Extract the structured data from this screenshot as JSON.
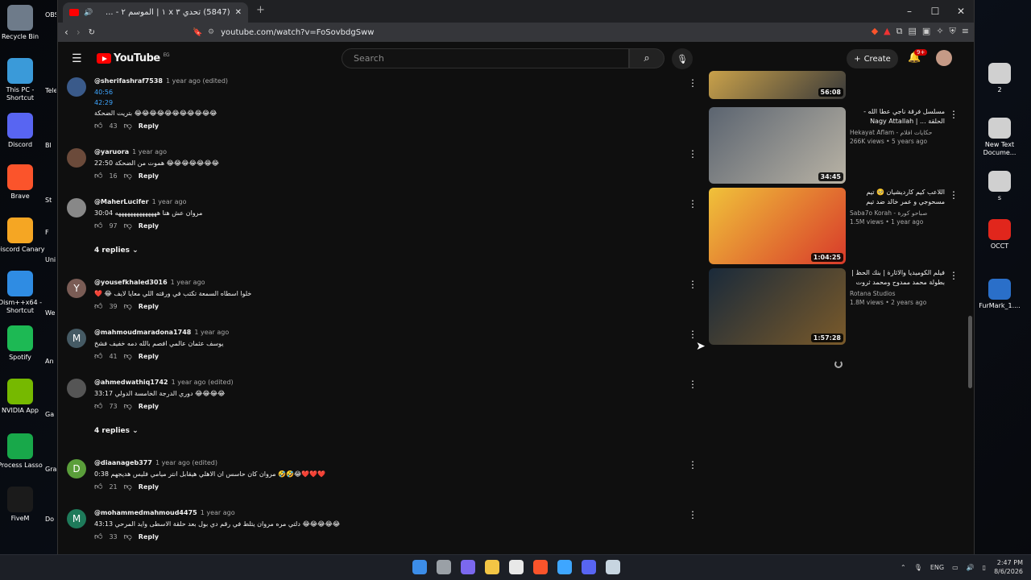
{
  "desktop": {
    "left_icons": [
      {
        "label": "Recycle Bin",
        "color": "#6e7b8a"
      },
      {
        "label": "This PC - Shortcut",
        "color": "#3a9ad9"
      },
      {
        "label": "Discord",
        "color": "#5865f2"
      },
      {
        "label": "Brave",
        "color": "#fb542b"
      },
      {
        "label": "Discord Canary",
        "color": "#f5a623"
      },
      {
        "label": "Dism++x64 - Shortcut",
        "color": "#2f8ce3"
      },
      {
        "label": "Spotify",
        "color": "#1db954"
      },
      {
        "label": "NVIDIA App",
        "color": "#76b900"
      },
      {
        "label": "Process Lasso",
        "color": "#18a84a"
      },
      {
        "label": "FiveM",
        "color": "#1b1b1b"
      }
    ],
    "partial_labels": [
      "OBS",
      "Tele",
      "Bl",
      "St",
      "F",
      "Uni",
      "We",
      "An",
      "Ga",
      "Gran Auto",
      "Do"
    ],
    "right_icons": [
      {
        "label": "2",
        "color": "#d0d0d0"
      },
      {
        "label": "New Text Docume...",
        "color": "#d0d0d0"
      },
      {
        "label": "s",
        "color": "#d0d0d0"
      },
      {
        "label": "OCCT",
        "color": "#e1261c"
      },
      {
        "label": "FurMark_1....",
        "color": "#2a6fc9"
      }
    ]
  },
  "browser": {
    "tab_title": "(5847) تحدي ٣ x ١ | الموسم ٢ - ...",
    "new_tab": "+",
    "url": "youtube.com/watch?v=FoSovbdgSww",
    "window_controls": [
      "–",
      "☐",
      "✕"
    ]
  },
  "youtube": {
    "logo_text": "YouTube",
    "logo_region": "EG",
    "search_placeholder": "Search",
    "create_label": "Create",
    "notif_count": "9+"
  },
  "comments": [
    {
      "handle": "@sherifashraf7538",
      "when": "1 year ago (edited)",
      "lines": [
        "40:56",
        "42:29",
        "😂😂😂😂😂😂😂😂😂😂😂 بتريت الضحكة"
      ],
      "likes": "43",
      "avatar_letter": "",
      "avatar_color": "#3a5a8a"
    },
    {
      "handle": "@yaruora",
      "when": "1 year ago",
      "lines": [
        "😂😂😂😂😂😂😂 هموت من الضحكة 22:50"
      ],
      "likes": "16",
      "avatar_letter": "",
      "avatar_color": "#6b4a3a"
    },
    {
      "handle": "@MaherLucifer",
      "when": "1 year ago",
      "lines": [
        "مروان عش هنا ههههههههههههههه 30:04"
      ],
      "likes": "97",
      "avatar_letter": "",
      "avatar_color": "#888888",
      "replies": "4 replies"
    },
    {
      "handle": "@yousefkhaled3016",
      "when": "1 year ago",
      "lines": [
        "خلوا اسطاه السمعة تكتب في ورقته اللي معايا لايف 😂 ❤️"
      ],
      "likes": "39",
      "avatar_letter": "Y",
      "avatar_color": "#7a5c55"
    },
    {
      "handle": "@mahmoudmaradona1748",
      "when": "1 year ago",
      "lines": [
        "يوسف عثمان عالمي افصم بالله دمه خفيف فشخ"
      ],
      "likes": "41",
      "avatar_letter": "M",
      "avatar_color": "#455a64"
    },
    {
      "handle": "@ahmedwathiq1742",
      "when": "1 year ago (edited)",
      "lines": [
        "😂😂😂😂 دوري الدرجة الخامسة الدولي 33:17"
      ],
      "likes": "73",
      "avatar_letter": "",
      "avatar_color": "#555555",
      "replies": "4 replies"
    },
    {
      "handle": "@diaanageb377",
      "when": "1 year ago (edited)",
      "lines": [
        "❤️❤️❤️😂🤣🤣 مروان كان حاسس ان الاهلي هيقابل انتر ميامي فليس هديجهم 0:38"
      ],
      "likes": "21",
      "avatar_letter": "D",
      "avatar_color": "#5a9e3a"
    },
    {
      "handle": "@mohammedmahmoud4475",
      "when": "1 year ago",
      "lines": [
        "😂😂😂😂😂 دلتي مره مروان يتلط في رقم دي بول بعد حلقة الاسطى وايد المرحي 43:13"
      ],
      "likes": "33",
      "avatar_letter": "M",
      "avatar_color": "#1e7a5a"
    }
  ],
  "reply_label": "Reply",
  "sidebar_videos": [
    {
      "title": "",
      "channel": "",
      "views": "",
      "duration": "56:08",
      "colors": [
        "#c9a14a",
        "#3a3a3a"
      ]
    },
    {
      "title": "مسلسل فرقة ناجي عطا الله - الحلقة ... | Nagy Attallah Squad",
      "channel": "Hekayat Aflam - حكايات افلام",
      "views": "266K views • 5 years ago",
      "duration": "34:45",
      "colors": [
        "#5b6470",
        "#b9b3a5"
      ]
    },
    {
      "title": "اللاعب كيم كارديشيان 🥺 تيم مسحوجي و عمر خالد ضد تيم مرعي و ...",
      "channel": "Saba7o Korah - صباحو كورة",
      "views": "1.5M views • 1 year ago",
      "duration": "1:04:25",
      "colors": [
        "#f0c23a",
        "#d83a2a"
      ]
    },
    {
      "title": "فيلم الكوميديا والاثارة | بنك الحظ | بطولة محمد ممدوح ومحمد ثروت",
      "channel": "Rotana Studios",
      "views": "1.8M views • 2 years ago",
      "duration": "1:57:28",
      "colors": [
        "#1a2a3a",
        "#7a5a2a"
      ]
    }
  ],
  "taskbar": {
    "icons": [
      {
        "name": "windows-start-icon",
        "color": "#3c8de8"
      },
      {
        "name": "task-view-icon",
        "color": "#9aa0a6"
      },
      {
        "name": "visual-studio-icon",
        "color": "#7b68ee"
      },
      {
        "name": "file-explorer-icon",
        "color": "#f3c545"
      },
      {
        "name": "calculator-icon",
        "color": "#e8e8e8"
      },
      {
        "name": "brave-icon",
        "color": "#fb542b"
      },
      {
        "name": "browser-icon",
        "color": "#3ea6ff"
      },
      {
        "name": "discord-icon",
        "color": "#5865f2"
      },
      {
        "name": "steam-icon",
        "color": "#c7d5e0"
      }
    ],
    "lang": "ENG",
    "time": "2:47 PM",
    "date": "8/6/2026"
  }
}
